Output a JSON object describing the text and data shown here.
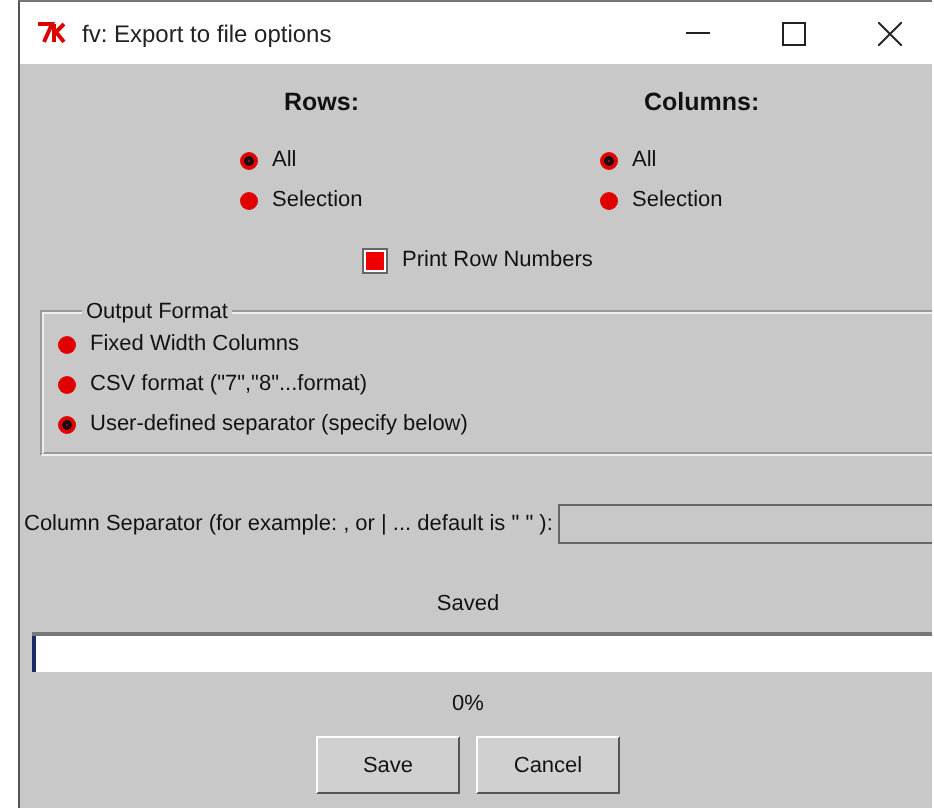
{
  "window": {
    "title": "fv: Export to file options"
  },
  "rows": {
    "heading": "Rows:",
    "options": [
      {
        "label": "All",
        "selected": true
      },
      {
        "label": "Selection",
        "selected": false
      }
    ]
  },
  "columns": {
    "heading": "Columns:",
    "options": [
      {
        "label": "All",
        "selected": true
      },
      {
        "label": "Selection",
        "selected": false
      }
    ]
  },
  "print_row_numbers": {
    "label": "Print Row Numbers",
    "checked": true
  },
  "output_format": {
    "title": "Output Format",
    "options": [
      {
        "label": "Fixed Width Columns",
        "selected": false
      },
      {
        "label": "CSV format (\"7\",\"8\"...format)",
        "selected": false
      },
      {
        "label": "User-defined separator (specify below)",
        "selected": true
      }
    ]
  },
  "column_separator": {
    "label": "Column Separator (for example: , or | ... default is \" \" ):"
  },
  "progress": {
    "title": "Saved",
    "level": 0,
    "reading": "0%"
  },
  "buttons": [
    "Save",
    "Cancel"
  ]
}
